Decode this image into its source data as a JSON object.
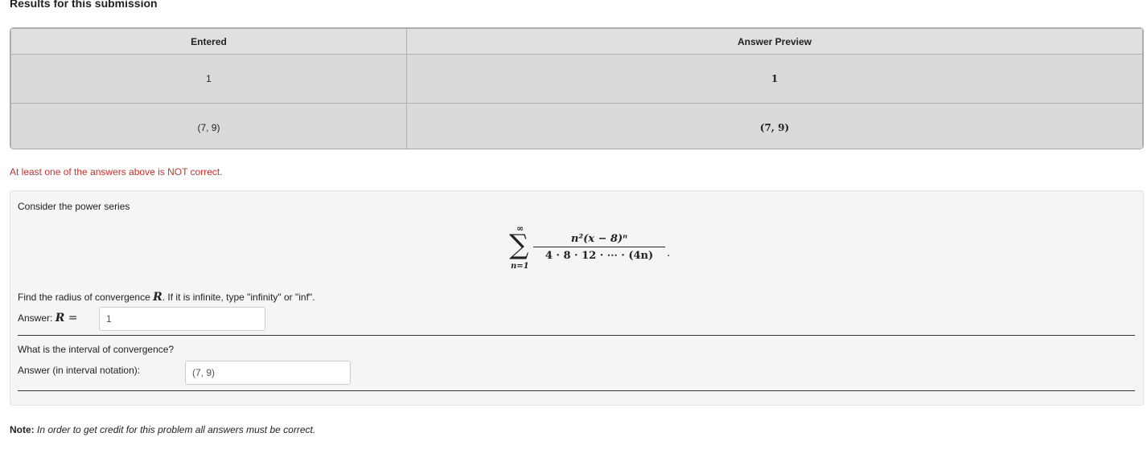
{
  "heading": "Results for this submission",
  "results_table": {
    "headers": [
      "Entered",
      "Answer Preview"
    ],
    "rows": [
      {
        "entered": "1",
        "preview": "1"
      },
      {
        "entered": "(7, 9)",
        "preview": "(7, 9)"
      }
    ]
  },
  "status_message": "At least one of the answers above is NOT correct.",
  "problem": {
    "intro": "Consider the power series",
    "series": {
      "sum_upper": "∞",
      "sum_lower": "n=1",
      "numerator": "n²(x − 8)ⁿ",
      "denominator": "4 · 8 · 12 · ⋯ · (4n)",
      "trailing": "."
    },
    "q1": {
      "text_before": "Find the radius of convergence ",
      "variable": "R",
      "text_after": ". If it is infinite, type \"infinity\" or \"inf\".",
      "answer_label": "Answer: ",
      "answer_var": "R",
      "equals": " =",
      "value": "1"
    },
    "q2": {
      "text": "What is the interval of convergence?",
      "answer_label": "Answer (in interval notation):",
      "value": "(7, 9)"
    }
  },
  "note": {
    "label": "Note:",
    "text": "In order to get credit for this problem all answers must be correct."
  }
}
